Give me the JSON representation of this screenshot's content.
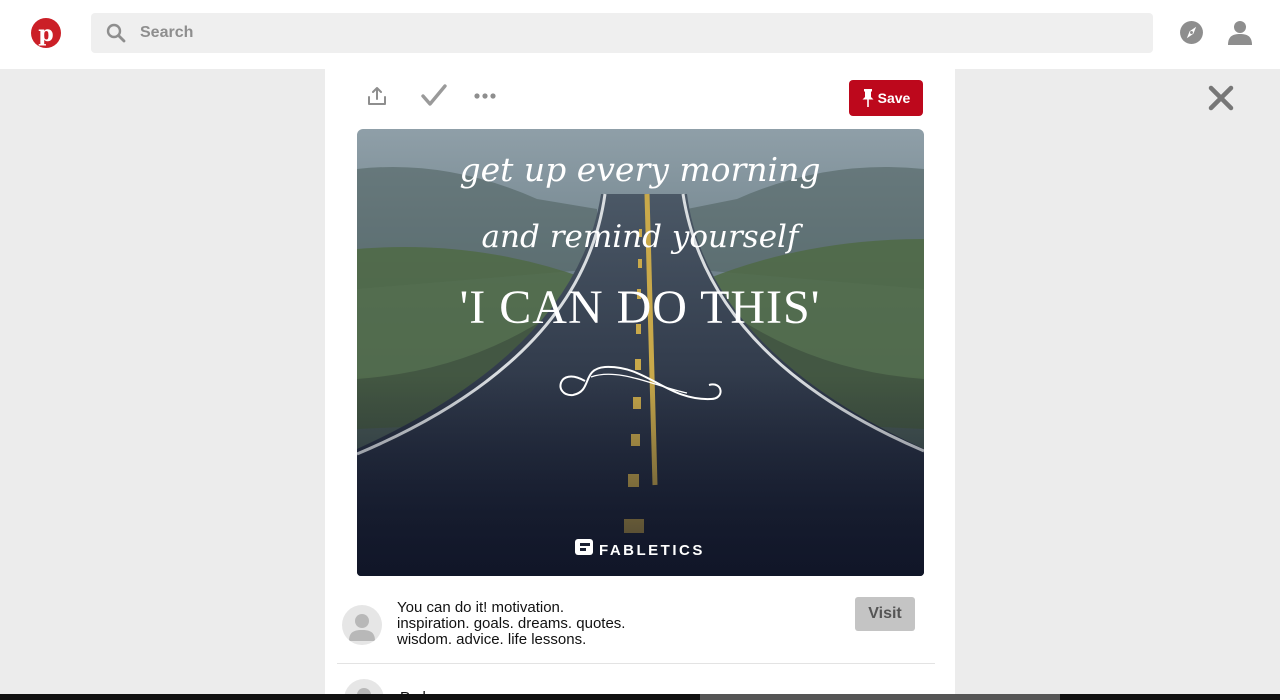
{
  "header": {
    "logo_glyph": "p",
    "search_placeholder": "Search",
    "icons": {
      "logo": "pinterest-logo-icon",
      "search": "search-icon",
      "explore": "compass-icon",
      "profile": "user-icon"
    }
  },
  "pin_actions": {
    "icons": [
      "share-icon",
      "check-icon",
      "more-icon"
    ],
    "save_label": "Save"
  },
  "pin_image": {
    "line1": "get up every morning",
    "line2": "and remind yourself",
    "headline": "'I CAN DO THIS'",
    "brand": "FABLETICS"
  },
  "pin_details": {
    "description_lines": [
      "You can do it! motivation.",
      "inspiration. goals. dreams. quotes.",
      "wisdom. advice. life lessons."
    ],
    "visit_label": "Visit",
    "next_text": "Pn l"
  },
  "colors": {
    "brand_red": "#bd081c",
    "logo_red": "#cb1f27",
    "page_bg": "#ececec"
  }
}
